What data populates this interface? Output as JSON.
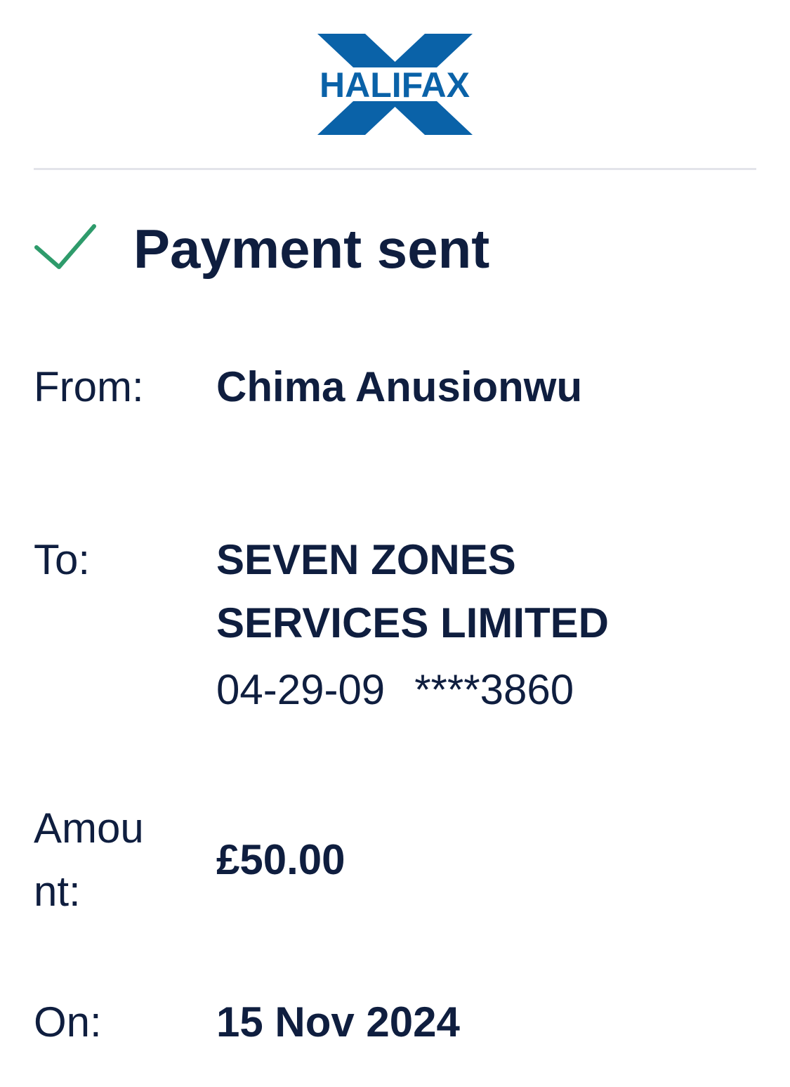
{
  "brand": {
    "name": "HALIFAX",
    "colors": {
      "blue": "#0a62a8",
      "navy": "#0f1e3f",
      "check": "#2e9b6b",
      "divider": "#e3e4ea"
    }
  },
  "status": {
    "title": "Payment sent",
    "icon": "check-icon"
  },
  "details": {
    "from": {
      "label": "From:",
      "value": "Chima Anusionwu"
    },
    "to": {
      "label": "To:",
      "line1": "SEVEN ZONES",
      "line2": "SERVICES LIMITED",
      "sort_code": "04-29-09",
      "account": "****3860"
    },
    "amount": {
      "label_line1": "Amou",
      "label_line2": "nt:",
      "value": "£50.00"
    },
    "date": {
      "label": "On:",
      "value": "15 Nov 2024"
    }
  }
}
